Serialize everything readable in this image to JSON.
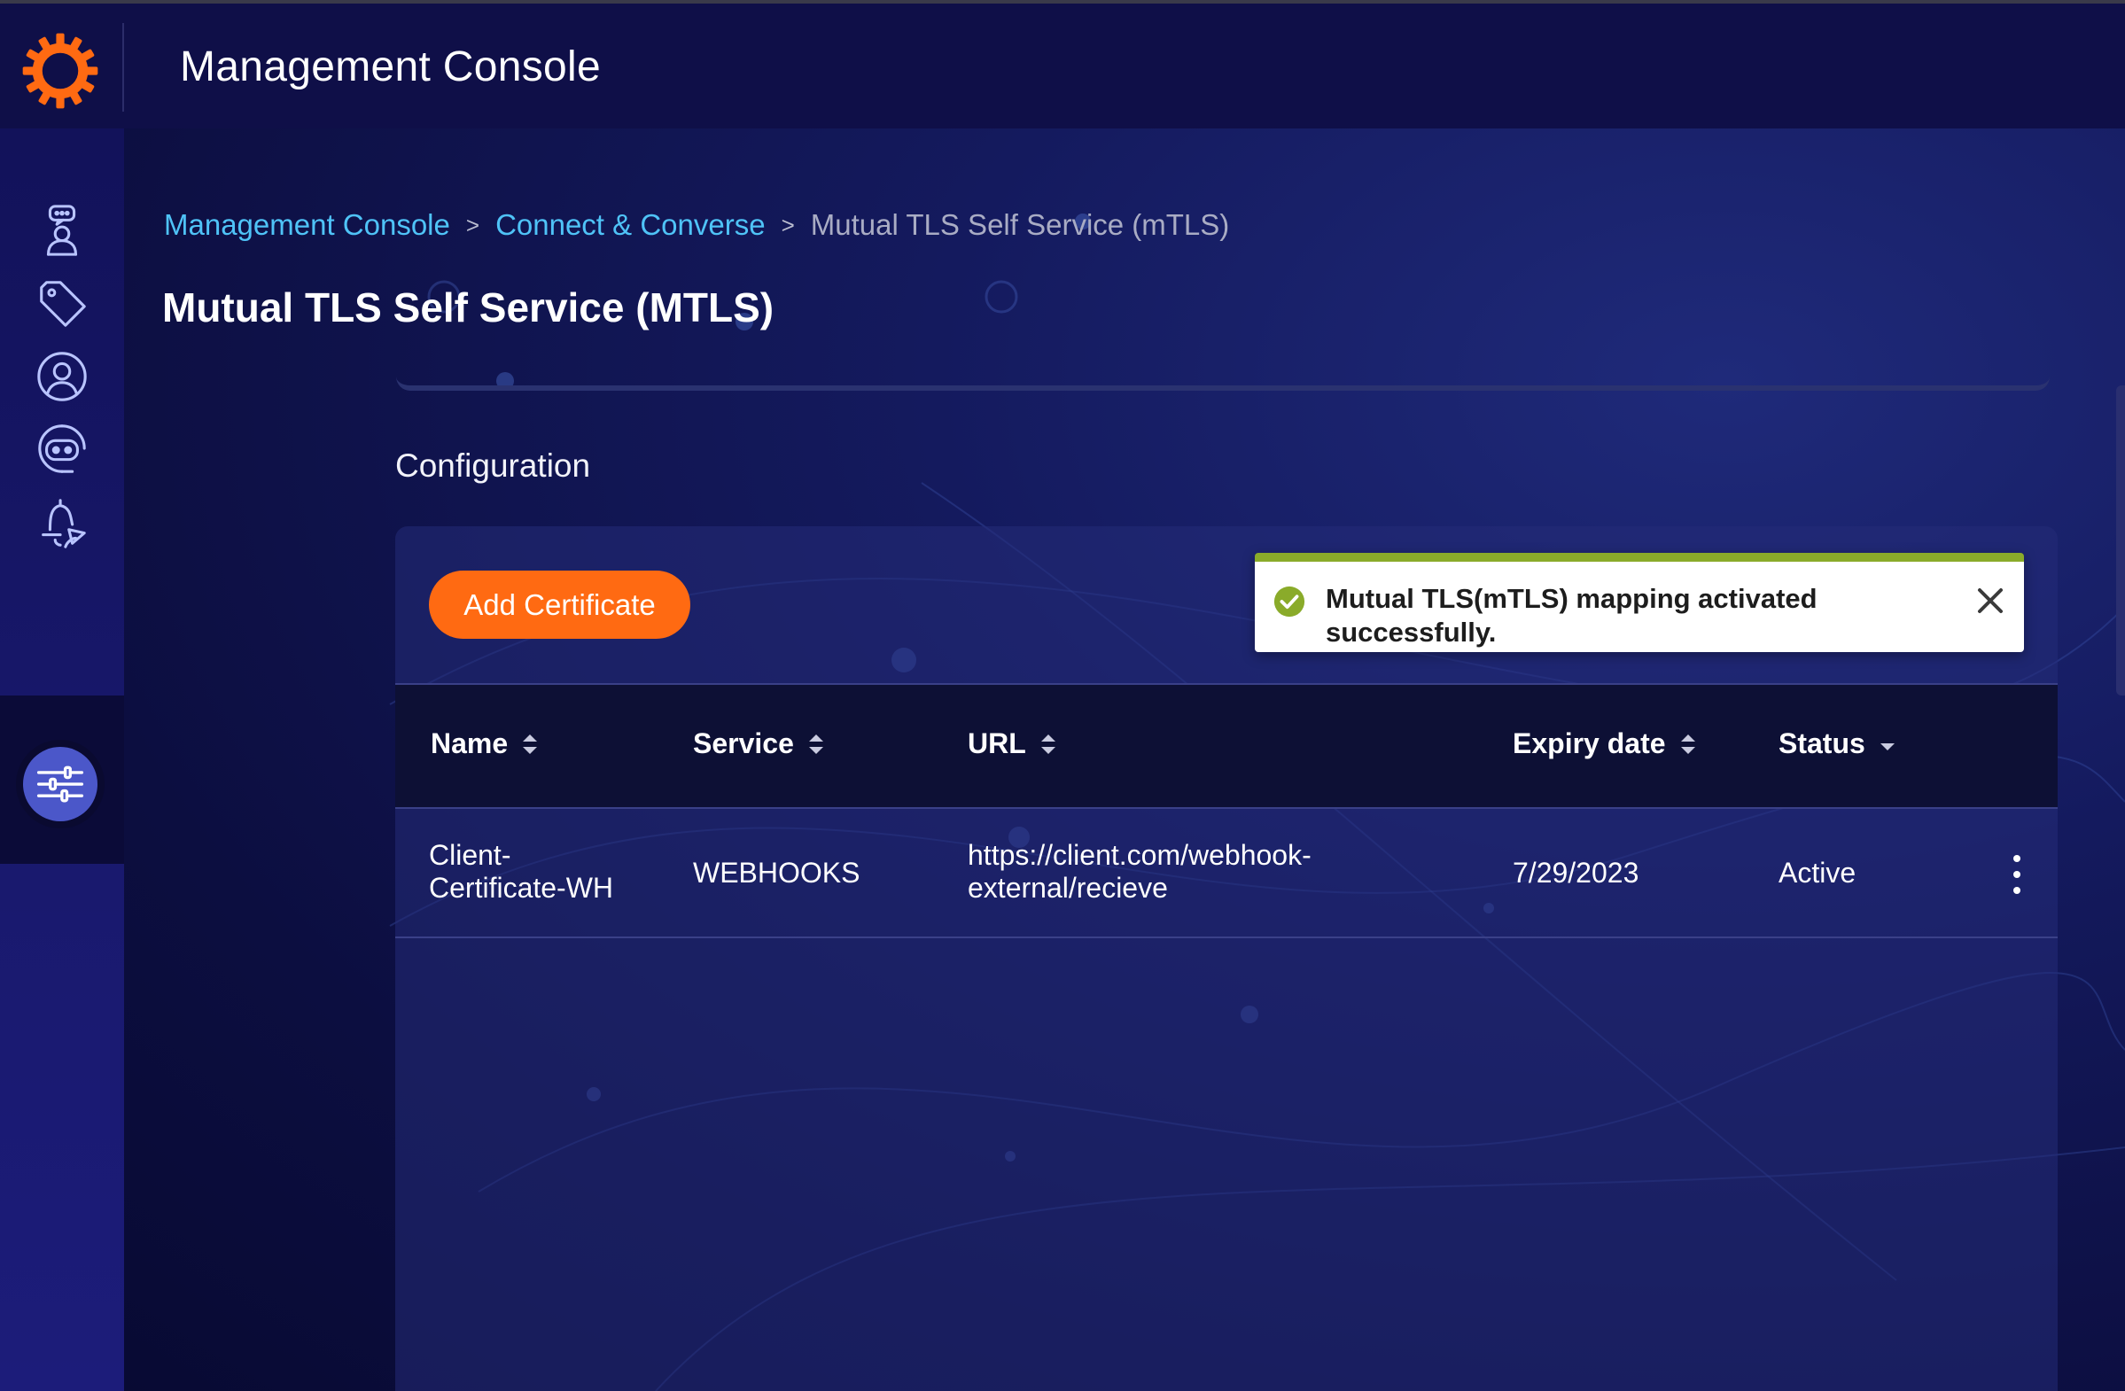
{
  "header": {
    "title": "Management Console",
    "logo": "gear-logo-icon",
    "accent_color": "#ff6a12"
  },
  "sidebar": {
    "items": [
      {
        "icon": "agent-chat-icon",
        "active": false
      },
      {
        "icon": "tag-icon",
        "active": false
      },
      {
        "icon": "user-profile-icon",
        "active": false
      },
      {
        "icon": "bot-icon",
        "active": false
      },
      {
        "icon": "notification-bell-icon",
        "active": false
      },
      {
        "icon": "settings-sliders-icon",
        "active": true
      }
    ]
  },
  "breadcrumb": {
    "items": [
      "Management Console",
      "Connect & Converse"
    ],
    "separator": ">",
    "current": "Mutual TLS Self Service (mTLS)"
  },
  "page": {
    "title": "Mutual TLS Self Service (MTLS)",
    "section_label": "Configuration"
  },
  "toolbar": {
    "add_label": "Add Certificate"
  },
  "toast": {
    "message": "Mutual TLS(mTLS) mapping activated successfully.",
    "status_color": "#8aab2a",
    "icon": "check-circle-icon"
  },
  "table": {
    "columns": [
      "Name",
      "Service",
      "URL",
      "Expiry date",
      "Status"
    ],
    "rows": [
      {
        "name": "Client-Certificate-WH",
        "service": "WEBHOOKS",
        "url": "https://client.com/webhook-external/recieve",
        "expiry": "7/29/2023",
        "status": "Active"
      }
    ]
  }
}
